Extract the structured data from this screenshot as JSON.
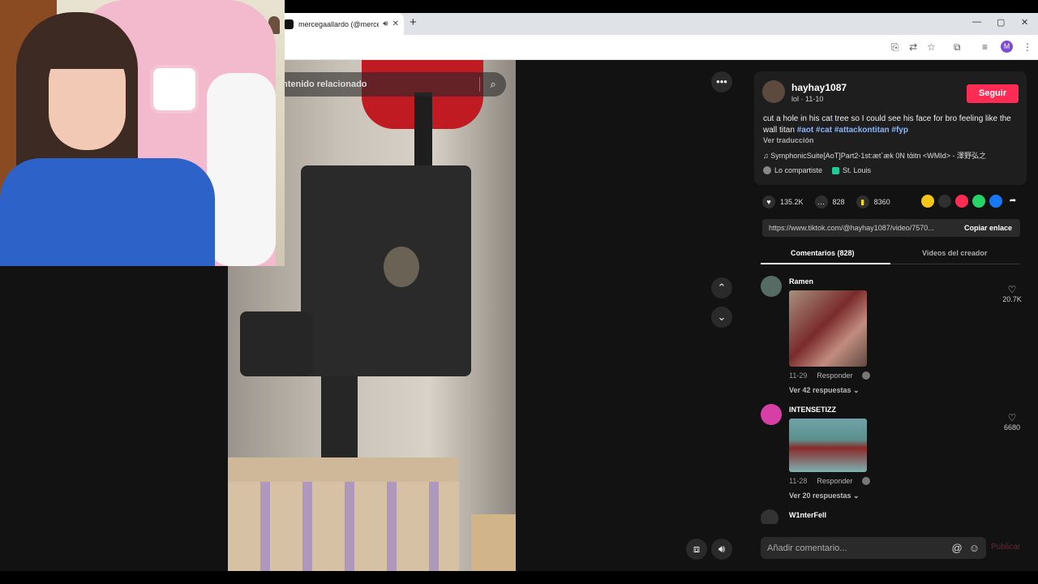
{
  "browser": {
    "tab_title": "mercegaallardo (@mercega",
    "new_tab": "+",
    "minimize": "—",
    "maximize": "▢",
    "close": "✕",
    "profile_initial": "M"
  },
  "video": {
    "search_placeholder": "ntenido relacionado",
    "more_icon": "•••",
    "up_icon": "⌃",
    "down_icon": "⌄"
  },
  "post": {
    "username": "hayhay1087",
    "subtitle": "lol · 11-10",
    "follow_label": "Seguir",
    "description_text": "cut a hole in his cat tree so I could see his face for bro feeling like the wall titan",
    "hashtags": "#aot #cat #attackontitan #fyp",
    "translate_label": "Ver traducción",
    "music": "SymphonicSuite[AoT]Part2-1st:æt`æk 0N tάitn <WMId> - 澤野弘之",
    "shared_label": "Lo compartiste",
    "location": "St. Louis",
    "likes": "135.2K",
    "comments": "828",
    "saves": "8360",
    "url": "https://www.tiktok.com/@hayhay1087/video/7570...",
    "copy_label": "Copiar enlace"
  },
  "tabs": {
    "comments_label": "Comentarios (828)",
    "creator_label": "Videos del creador"
  },
  "comments": [
    {
      "name": "Ramen",
      "date": "11-29",
      "reply": "Responder",
      "more": "Ver 42 respuestas ⌄",
      "likes": "20.7K"
    },
    {
      "name": "INTENSETIZZ",
      "date": "11-28",
      "reply": "Responder",
      "more": "Ver 20 respuestas ⌄",
      "likes": "6680"
    },
    {
      "name": "W1nterFell"
    }
  ],
  "composer": {
    "placeholder": "Añadir comentario...",
    "at_icon": "@",
    "emoji_icon": "☺",
    "publish_label": "Publicar"
  },
  "colors": {
    "accent": "#fe2c55",
    "hashtag": "#8ab4f8"
  }
}
